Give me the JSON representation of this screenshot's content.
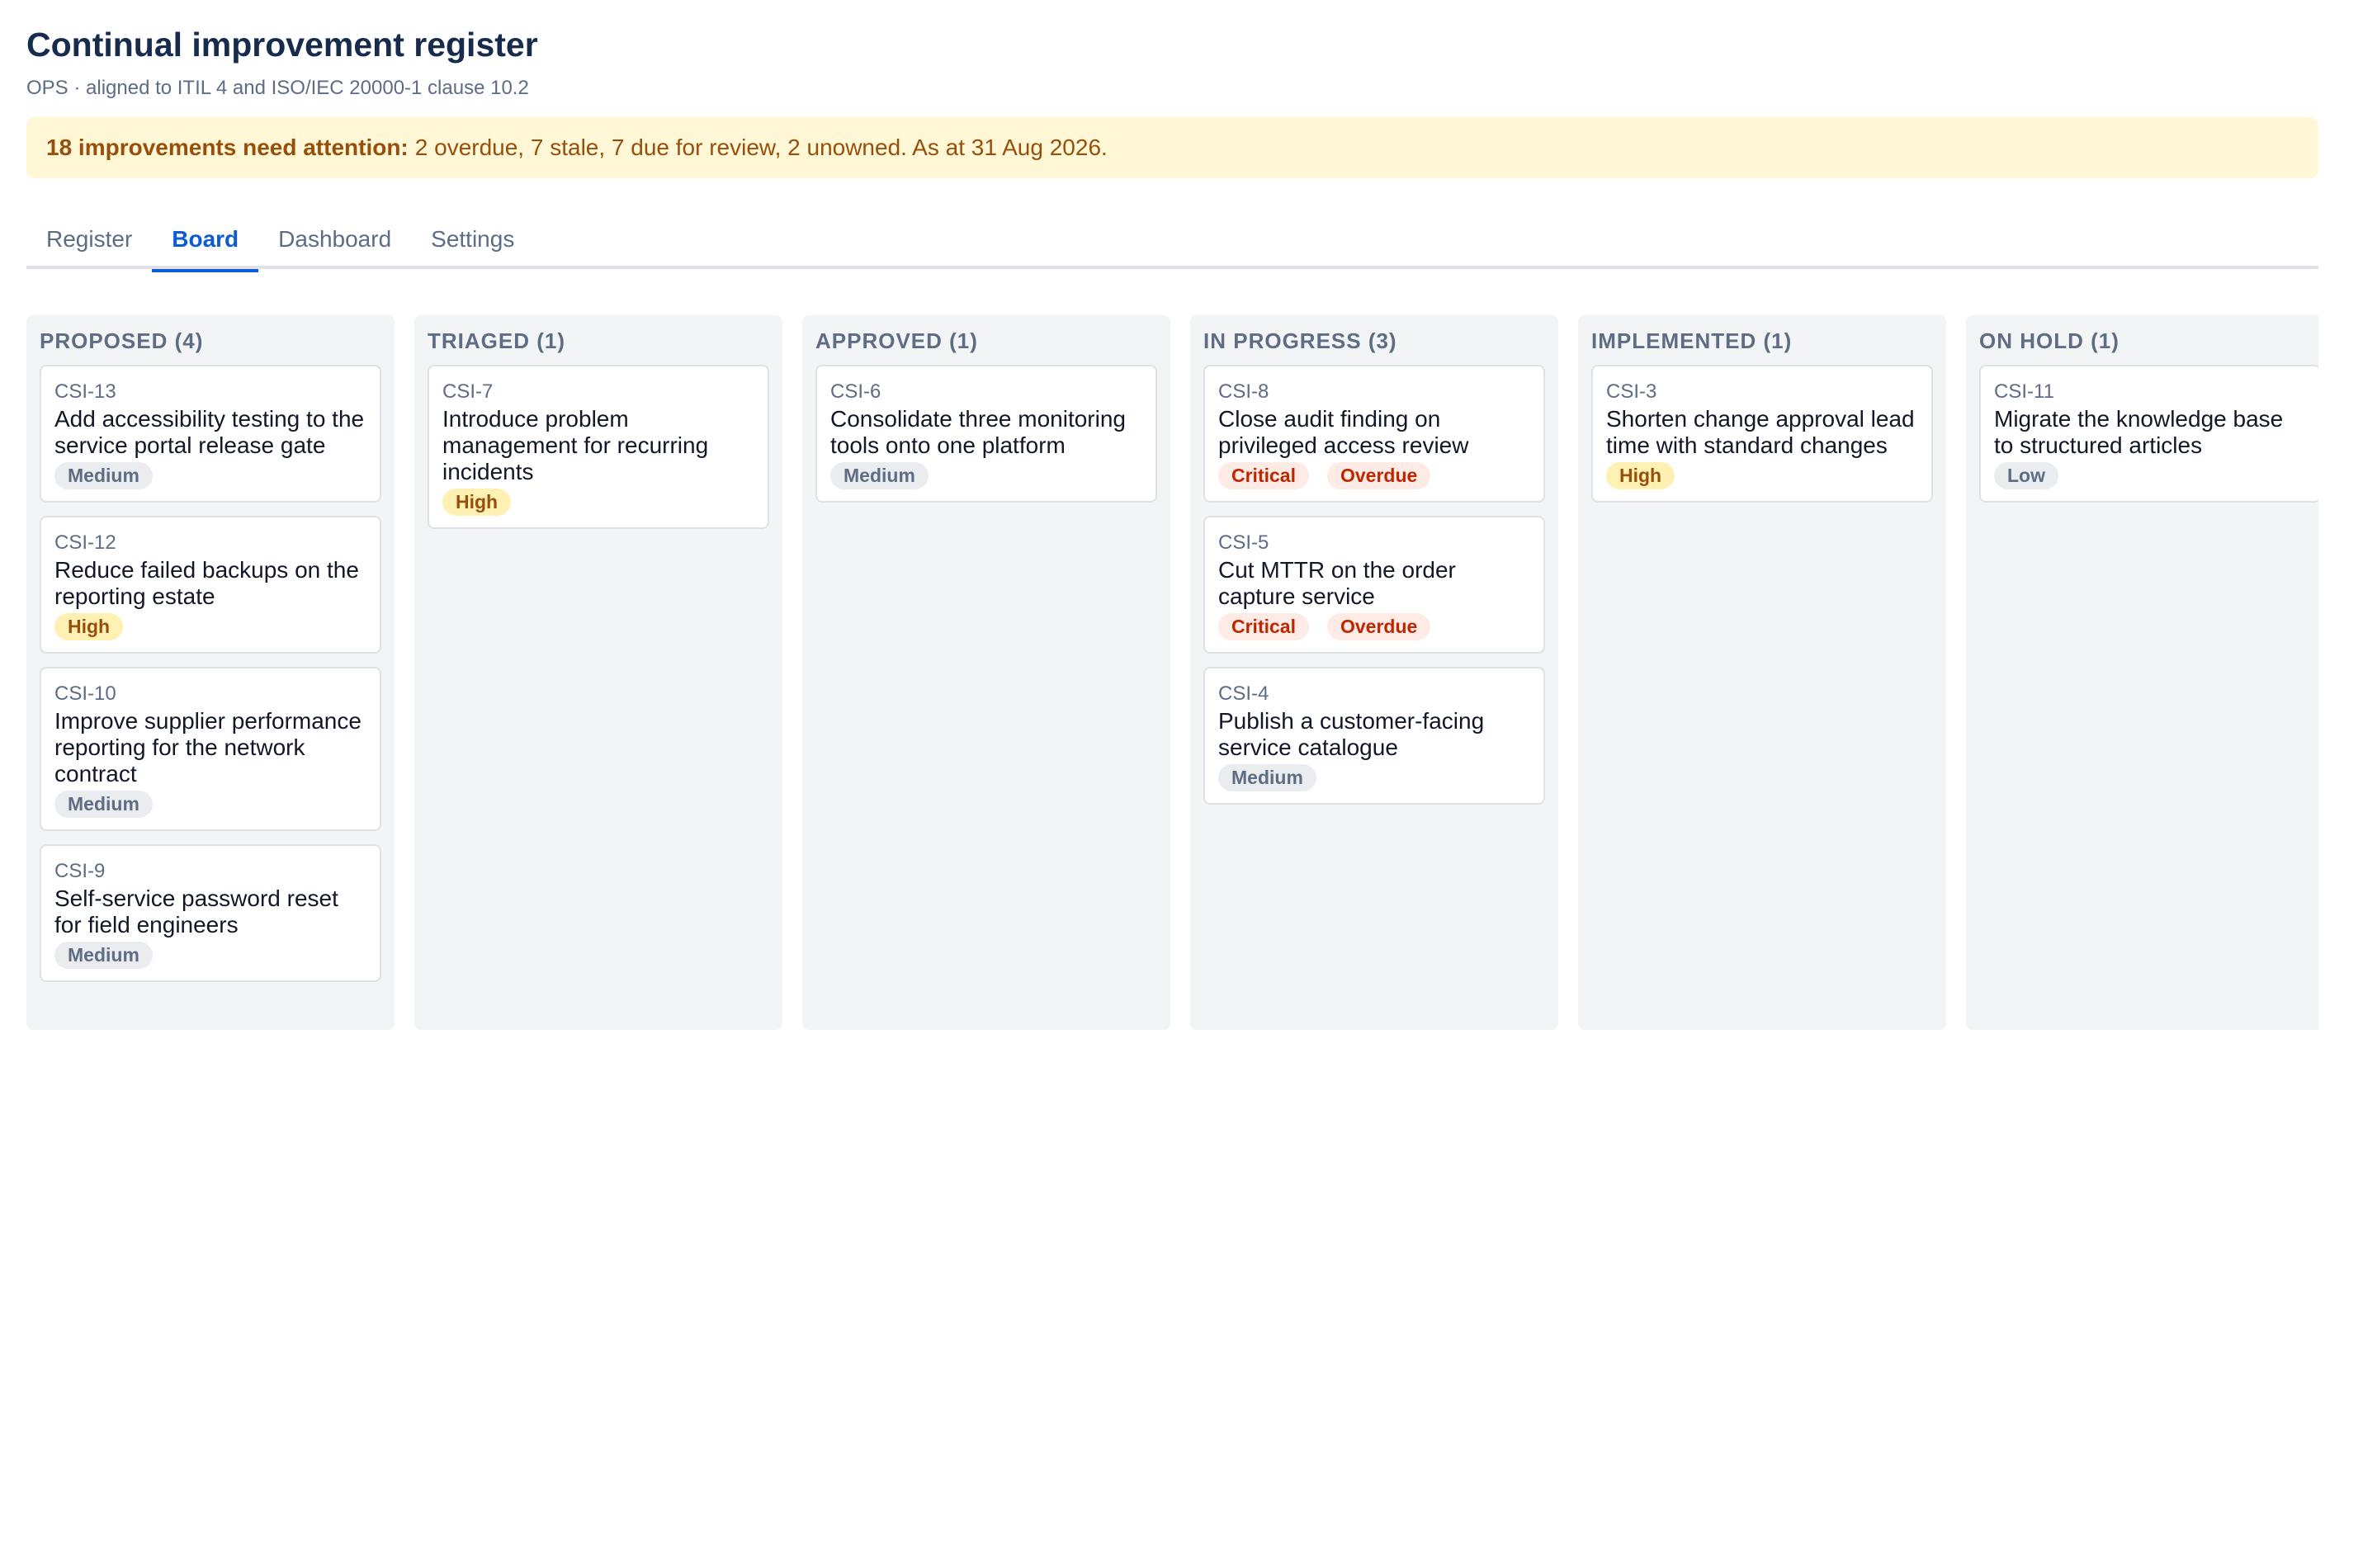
{
  "header": {
    "title": "Continual improvement register",
    "subtitle": "OPS · aligned to ITIL 4 and ISO/IEC 20000-1 clause 10.2"
  },
  "banner": {
    "strong": "18 improvements need attention:",
    "text": "2 overdue, 7 stale, 7 due for review, 2 unowned. As at 31 Aug 2026."
  },
  "tabs": [
    {
      "label": "Register",
      "active": false
    },
    {
      "label": "Board",
      "active": true
    },
    {
      "label": "Dashboard",
      "active": false
    },
    {
      "label": "Settings",
      "active": false
    }
  ],
  "columns": [
    {
      "title": "PROPOSED (4)",
      "cards": [
        {
          "key": "CSI-13",
          "title": "Add accessibility testing to the service portal release gate",
          "chips": [
            {
              "label": "Medium",
              "kind": "medium"
            }
          ]
        },
        {
          "key": "CSI-12",
          "title": "Reduce failed backups on the reporting estate",
          "chips": [
            {
              "label": "High",
              "kind": "high"
            }
          ]
        },
        {
          "key": "CSI-10",
          "title": "Improve supplier performance reporting for the network contract",
          "chips": [
            {
              "label": "Medium",
              "kind": "medium"
            }
          ]
        },
        {
          "key": "CSI-9",
          "title": "Self-service password reset for field engineers",
          "chips": [
            {
              "label": "Medium",
              "kind": "medium"
            }
          ]
        }
      ]
    },
    {
      "title": "TRIAGED (1)",
      "cards": [
        {
          "key": "CSI-7",
          "title": "Introduce problem management for recurring incidents",
          "chips": [
            {
              "label": "High",
              "kind": "high"
            }
          ]
        }
      ]
    },
    {
      "title": "APPROVED (1)",
      "cards": [
        {
          "key": "CSI-6",
          "title": "Consolidate three monitoring tools onto one platform",
          "chips": [
            {
              "label": "Medium",
              "kind": "medium"
            }
          ]
        }
      ]
    },
    {
      "title": "IN PROGRESS (3)",
      "cards": [
        {
          "key": "CSI-8",
          "title": "Close audit finding on privileged access review",
          "chips": [
            {
              "label": "Critical",
              "kind": "critical"
            },
            {
              "label": "Overdue",
              "kind": "overdue"
            }
          ]
        },
        {
          "key": "CSI-5",
          "title": "Cut MTTR on the order capture service",
          "chips": [
            {
              "label": "Critical",
              "kind": "critical"
            },
            {
              "label": "Overdue",
              "kind": "overdue"
            }
          ]
        },
        {
          "key": "CSI-4",
          "title": "Publish a customer-facing service catalogue",
          "chips": [
            {
              "label": "Medium",
              "kind": "medium"
            }
          ]
        }
      ]
    },
    {
      "title": "IMPLEMENTED (1)",
      "cards": [
        {
          "key": "CSI-3",
          "title": "Shorten change approval lead time with standard changes",
          "chips": [
            {
              "label": "High",
              "kind": "high"
            }
          ]
        }
      ]
    },
    {
      "title": "ON HOLD (1)",
      "cards": [
        {
          "key": "CSI-11",
          "title": "Migrate the knowledge base to structured articles",
          "chips": [
            {
              "label": "Low",
              "kind": "low"
            }
          ]
        }
      ]
    }
  ]
}
